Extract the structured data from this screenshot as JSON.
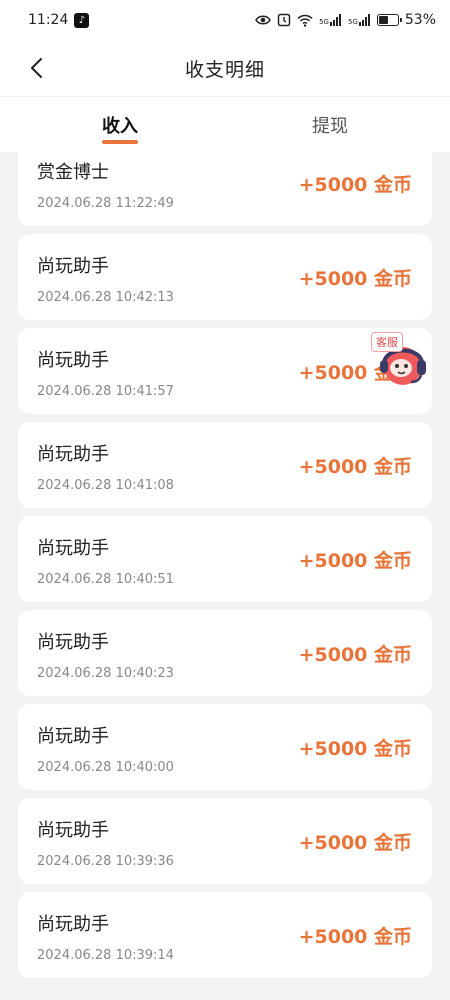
{
  "status_bar": {
    "time": "11:24",
    "tiktok_badge": "♪",
    "sig1": "5G",
    "sig2": "5G",
    "battery": "53%",
    "battery_level": 0.53
  },
  "nav": {
    "title": "收支明细"
  },
  "tabs": [
    {
      "label": "收入",
      "active": true
    },
    {
      "label": "提现",
      "active": false
    }
  ],
  "records": [
    {
      "source": "赏金博士",
      "time": "2024.06.28 11:22:49",
      "amount": "+5000 金币"
    },
    {
      "source": "尚玩助手",
      "time": "2024.06.28 10:42:13",
      "amount": "+5000 金币"
    },
    {
      "source": "尚玩助手",
      "time": "2024.06.28 10:41:57",
      "amount": "+5000 金币"
    },
    {
      "source": "尚玩助手",
      "time": "2024.06.28 10:41:08",
      "amount": "+5000 金币"
    },
    {
      "source": "尚玩助手",
      "time": "2024.06.28 10:40:51",
      "amount": "+5000 金币"
    },
    {
      "source": "尚玩助手",
      "time": "2024.06.28 10:40:23",
      "amount": "+5000 金币"
    },
    {
      "source": "尚玩助手",
      "time": "2024.06.28 10:40:00",
      "amount": "+5000 金币"
    },
    {
      "source": "尚玩助手",
      "time": "2024.06.28 10:39:36",
      "amount": "+5000 金币"
    },
    {
      "source": "尚玩助手",
      "time": "2024.06.28 10:39:14",
      "amount": "+5000 金币"
    }
  ],
  "customer_service": {
    "label": "客服"
  },
  "colors": {
    "accent": "#e8743a",
    "background": "#f3f3f3"
  }
}
